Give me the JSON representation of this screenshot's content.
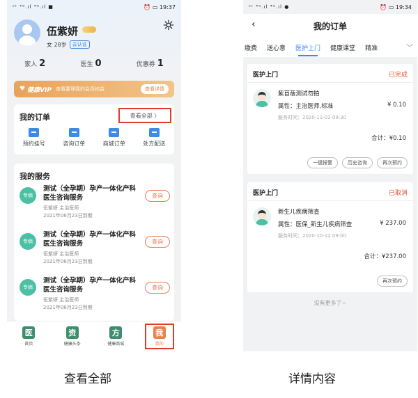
{
  "left": {
    "status": {
      "left": "ᵒᵗ ⁴ᴳ.ıl ⁴ᴳ.ıl ■",
      "right": "⏰ ▭ 19:37"
    },
    "profile": {
      "name": "伍紫妍",
      "meta": "女 28岁",
      "verify": "去认证"
    },
    "stats": [
      {
        "label": "家人",
        "value": "2"
      },
      {
        "label": "医生",
        "value": "0"
      },
      {
        "label": "优惠券",
        "value": "1"
      }
    ],
    "vip": {
      "title": "健康VIP",
      "desc": "查看要理我的会员权益",
      "button": "查看详情"
    },
    "orders": {
      "title": "我的订单",
      "view_all": "查看全部 〉",
      "items": [
        "预约挂号",
        "咨询订单",
        "商城订单",
        "处方配送"
      ]
    },
    "services": {
      "title": "我的服务",
      "items": [
        {
          "badge": "专病",
          "title": "测试（全孕期）孕产一体化产科医生咨询服务",
          "doctor": "伍紫妍 主治医师",
          "expire": "2021年06月23日到期",
          "button": "查询"
        },
        {
          "badge": "专病",
          "title": "测试（全孕期）孕产一体化产科医生咨询服务",
          "doctor": "伍紫妍 主治医师",
          "expire": "2021年06月23日到期",
          "button": "查询"
        },
        {
          "badge": "专病",
          "title": "测试（全孕期）孕产一体化产科医生咨询服务",
          "doctor": "伍紫妍 主治医师",
          "expire": "2021年06月23日到期",
          "button": "查询"
        }
      ]
    },
    "tabs": [
      {
        "glyph": "医",
        "label": "首页"
      },
      {
        "glyph": "资",
        "label": "健康头条"
      },
      {
        "glyph": "方",
        "label": "健康商城"
      },
      {
        "glyph": "我",
        "label": "我的"
      }
    ]
  },
  "right": {
    "status": {
      "left": "ᵒᵗ ⁴ᴳ.ıl ⁴ᴳ.ıl ●",
      "right": "⏰ ▭ 19:34"
    },
    "header": {
      "back": "‹",
      "title": "我的订单"
    },
    "tabs": [
      "缴费",
      "送心意",
      "医护上门",
      "健康课堂",
      "精准"
    ],
    "chevron": "﹀",
    "orders": [
      {
        "head": "医护上门",
        "status": "已完成",
        "name": "紫苜蓿测试勿拍",
        "attr": "属性：主治医师,标准",
        "price": "¥ 0.10",
        "time": "服务时间：2020-11-02 09:30",
        "total": "合计：¥0.10",
        "buttons": [
          "一键报警",
          "历史咨询",
          "再次预约"
        ]
      },
      {
        "head": "医护上门",
        "status": "已取消",
        "name": "新生儿疾病筛查",
        "attr": "属性：医保_新生儿疾病筛查",
        "price": "¥ 237.00",
        "time": "服务时间：2020-10-12 09:00",
        "total": "合计：¥237.00",
        "buttons": [
          "再次预约"
        ]
      }
    ],
    "no_more": "没有更多了~"
  },
  "captions": {
    "left": "查看全部",
    "right": "详情内容"
  },
  "colors": {
    "accent_blue": "#3c8be8",
    "highlight_red": "#e43a2e",
    "orange": "#e8834f",
    "green": "#4cc0a5"
  }
}
